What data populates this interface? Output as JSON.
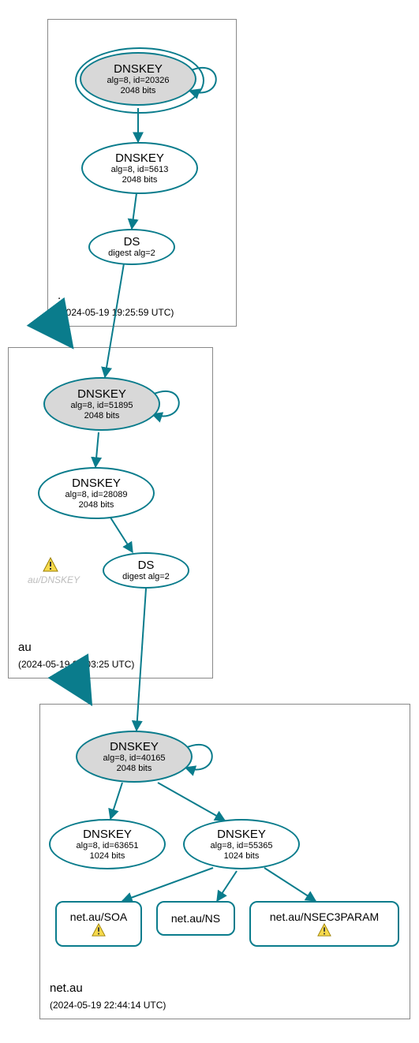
{
  "zones": {
    "root": {
      "name": ".",
      "timestamp": "(2024-05-19 19:25:59 UTC)"
    },
    "au": {
      "name": "au",
      "timestamp": "(2024-05-19 20:03:25 UTC)"
    },
    "netau": {
      "name": "net.au",
      "timestamp": "(2024-05-19 22:44:14 UTC)"
    }
  },
  "nodes": {
    "root_ksk": {
      "title": "DNSKEY",
      "line1": "alg=8, id=20326",
      "line2": "2048 bits"
    },
    "root_zsk": {
      "title": "DNSKEY",
      "line1": "alg=8, id=5613",
      "line2": "2048 bits"
    },
    "root_ds": {
      "title": "DS",
      "line1": "digest alg=2"
    },
    "au_ksk": {
      "title": "DNSKEY",
      "line1": "alg=8, id=51895",
      "line2": "2048 bits"
    },
    "au_zsk": {
      "title": "DNSKEY",
      "line1": "alg=8, id=28089",
      "line2": "2048 bits"
    },
    "au_ds": {
      "title": "DS",
      "line1": "digest alg=2"
    },
    "au_ghost": {
      "label": "au/DNSKEY"
    },
    "netau_ksk": {
      "title": "DNSKEY",
      "line1": "alg=8, id=40165",
      "line2": "2048 bits"
    },
    "netau_zsk1": {
      "title": "DNSKEY",
      "line1": "alg=8, id=63651",
      "line2": "1024 bits"
    },
    "netau_zsk2": {
      "title": "DNSKEY",
      "line1": "alg=8, id=55365",
      "line2": "1024 bits"
    },
    "netau_soa": {
      "label": "net.au/SOA"
    },
    "netau_ns": {
      "label": "net.au/NS"
    },
    "netau_n3p": {
      "label": "net.au/NSEC3PARAM"
    }
  },
  "colors": {
    "stroke": "#0a7c8c",
    "warn_fill": "#f6d94c",
    "warn_border": "#9a7e00"
  }
}
